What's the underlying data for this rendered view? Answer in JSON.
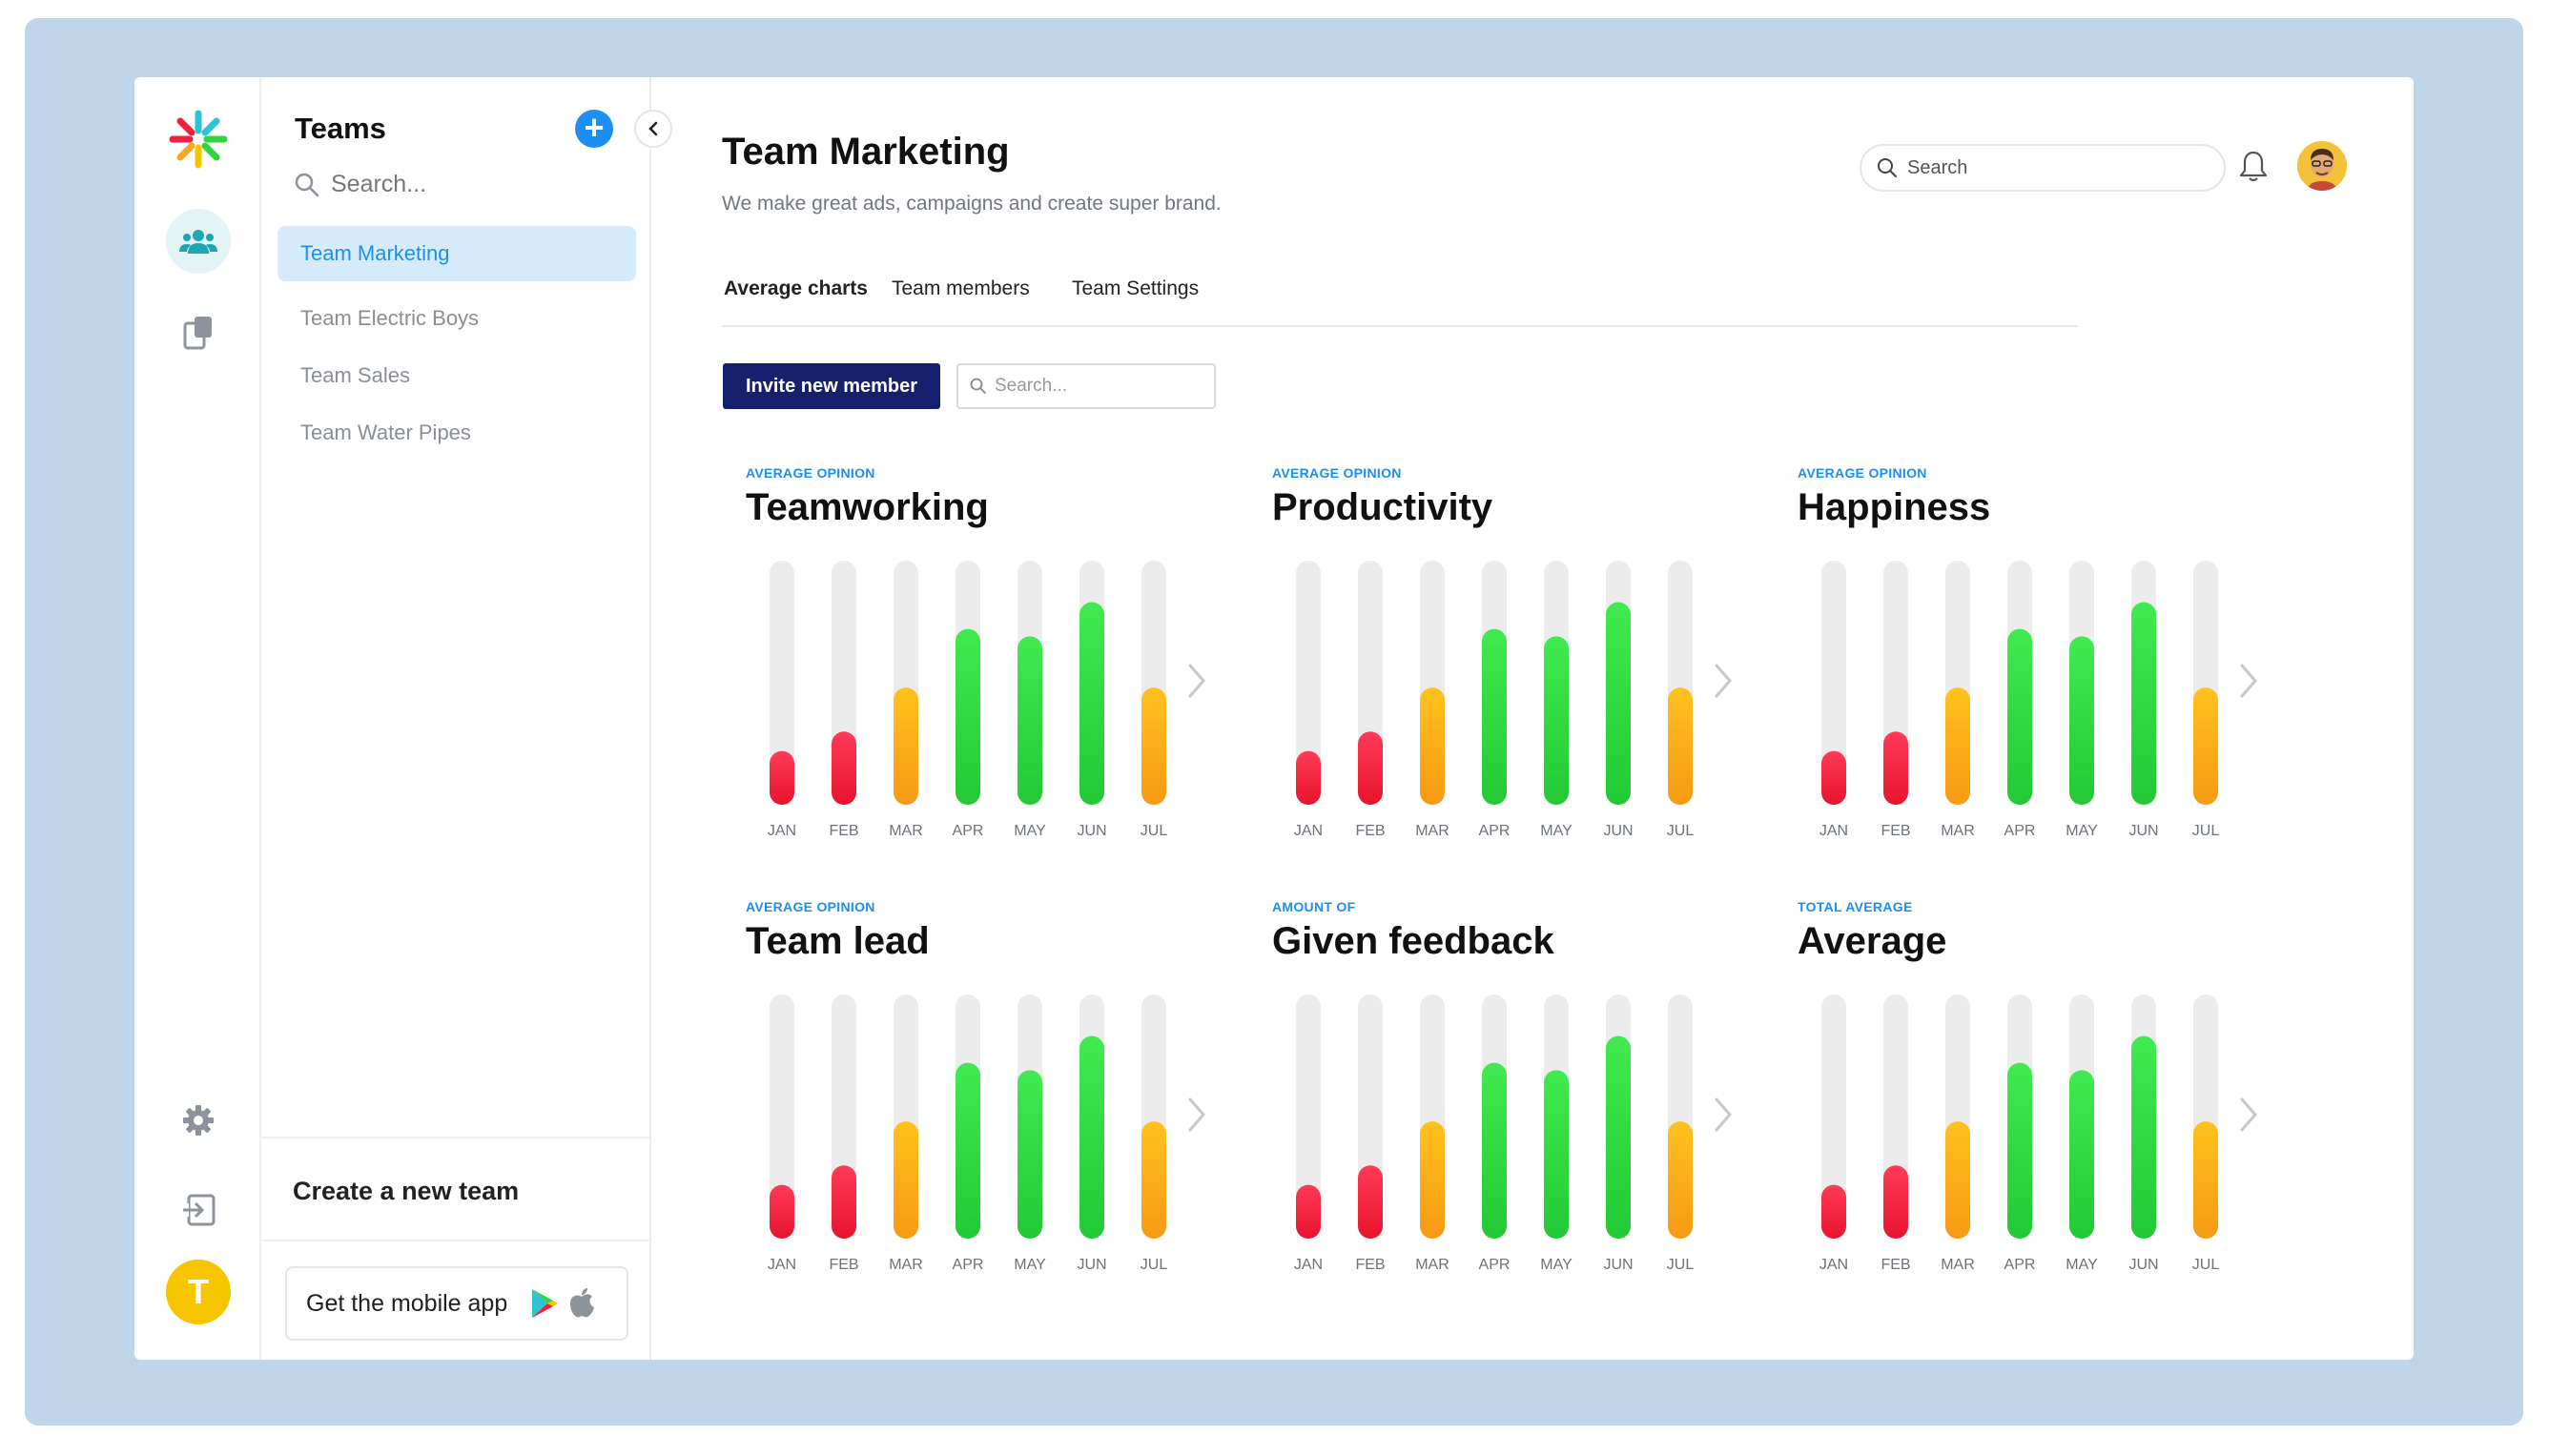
{
  "sidebar": {
    "icons": [
      "logo-icon",
      "users-icon",
      "copy-icon",
      "gear-icon",
      "logout-icon"
    ],
    "user_initial": "T",
    "active_color": "#1ba8b4"
  },
  "teams_panel": {
    "title": "Teams",
    "add_label": "+",
    "search_placeholder": "Search...",
    "items": [
      {
        "label": "Team Marketing",
        "active": true
      },
      {
        "label": "Team Electric Boys",
        "active": false
      },
      {
        "label": "Team Sales",
        "active": false
      },
      {
        "label": "Team Water Pipes",
        "active": false
      }
    ],
    "create_label": "Create a new team",
    "mobile_label": "Get the mobile app"
  },
  "header": {
    "title": "Team Marketing",
    "subtitle": "We make great ads, campaigns and create super brand.",
    "search_placeholder": "Search"
  },
  "tabs": [
    {
      "label": "Average charts",
      "active": true
    },
    {
      "label": "Team members",
      "active": false
    },
    {
      "label": "Team Settings",
      "active": false
    }
  ],
  "toolbar": {
    "invite_label": "Invite new member",
    "search_placeholder": "Search..."
  },
  "colors": {
    "accent": "#1e8ff2",
    "primary_button": "#15206f",
    "low": "#f0203e",
    "mid": "#f7a81b",
    "high": "#2fd63f",
    "track": "#ececec"
  },
  "chart_data": [
    {
      "type": "bar",
      "kicker": "AVERAGE OPINION",
      "title": "Teamworking",
      "categories": [
        "JAN",
        "FEB",
        "MAR",
        "APR",
        "MAY",
        "JUN",
        "JUL"
      ],
      "values": [
        22,
        30,
        48,
        72,
        69,
        83,
        48
      ],
      "ylim": [
        0,
        100
      ]
    },
    {
      "type": "bar",
      "kicker": "AVERAGE OPINION",
      "title": "Productivity",
      "categories": [
        "JAN",
        "FEB",
        "MAR",
        "APR",
        "MAY",
        "JUN",
        "JUL"
      ],
      "values": [
        22,
        30,
        48,
        72,
        69,
        83,
        48
      ],
      "ylim": [
        0,
        100
      ]
    },
    {
      "type": "bar",
      "kicker": "AVERAGE OPINION",
      "title": "Happiness",
      "categories": [
        "JAN",
        "FEB",
        "MAR",
        "APR",
        "MAY",
        "JUN",
        "JUL"
      ],
      "values": [
        22,
        30,
        48,
        72,
        69,
        83,
        48
      ],
      "ylim": [
        0,
        100
      ]
    },
    {
      "type": "bar",
      "kicker": "AVERAGE OPINION",
      "title": "Team lead",
      "categories": [
        "JAN",
        "FEB",
        "MAR",
        "APR",
        "MAY",
        "JUN",
        "JUL"
      ],
      "values": [
        22,
        30,
        48,
        72,
        69,
        83,
        48
      ],
      "ylim": [
        0,
        100
      ]
    },
    {
      "type": "bar",
      "kicker": "AMOUNT OF",
      "title": "Given feedback",
      "categories": [
        "JAN",
        "FEB",
        "MAR",
        "APR",
        "MAY",
        "JUN",
        "JUL"
      ],
      "values": [
        22,
        30,
        48,
        72,
        69,
        83,
        48
      ],
      "ylim": [
        0,
        100
      ]
    },
    {
      "type": "bar",
      "kicker": "TOTAL AVERAGE",
      "title": "Average",
      "categories": [
        "JAN",
        "FEB",
        "MAR",
        "APR",
        "MAY",
        "JUN",
        "JUL"
      ],
      "values": [
        22,
        30,
        48,
        72,
        69,
        83,
        48
      ],
      "ylim": [
        0,
        100
      ]
    }
  ]
}
